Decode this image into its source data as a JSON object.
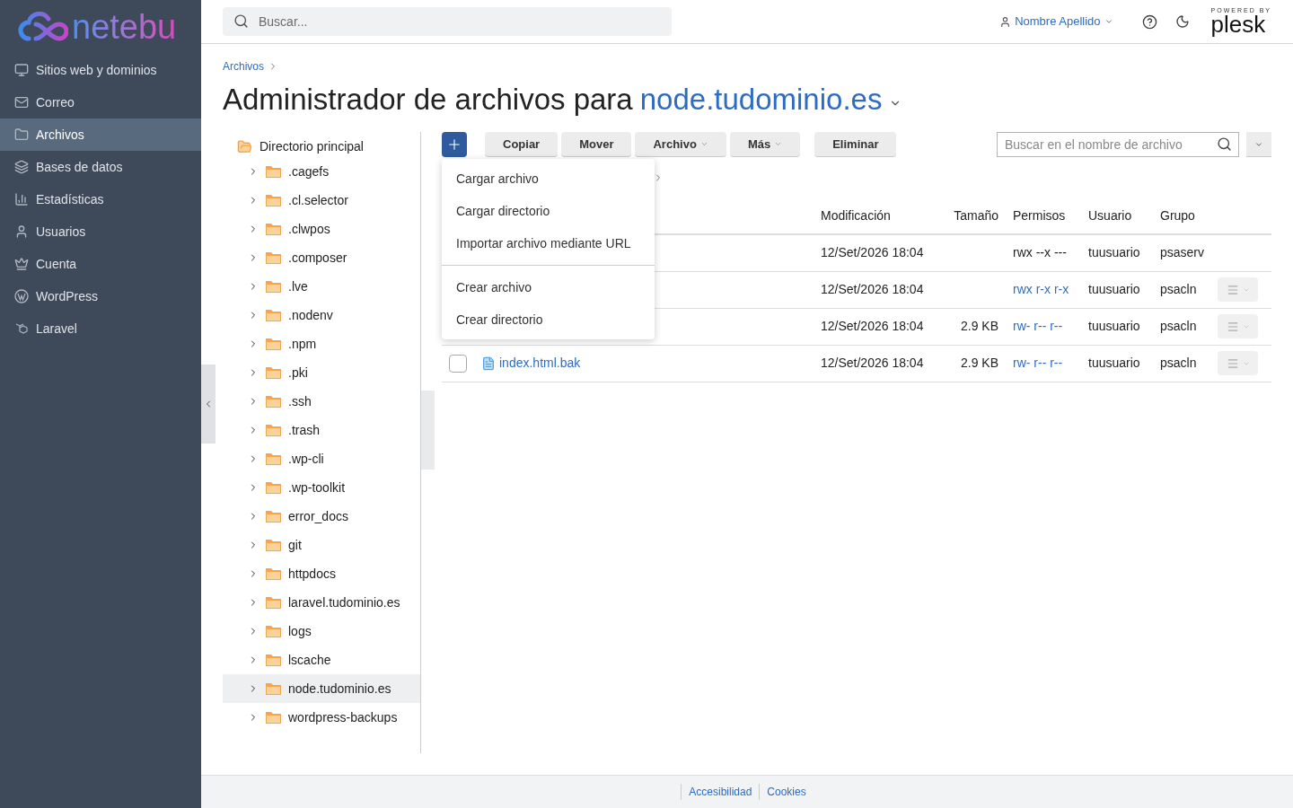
{
  "sidebar": {
    "logo": "netebu",
    "items": [
      {
        "label": "Sitios web y dominios",
        "selected": false
      },
      {
        "label": "Correo",
        "selected": false
      },
      {
        "label": "Archivos",
        "selected": true
      },
      {
        "label": "Bases de datos",
        "selected": false
      },
      {
        "label": "Estadísticas",
        "selected": false
      },
      {
        "label": "Usuarios",
        "selected": false
      },
      {
        "label": "Cuenta",
        "selected": false
      },
      {
        "label": "WordPress",
        "selected": false
      },
      {
        "label": "Laravel",
        "selected": false
      }
    ]
  },
  "header": {
    "search_placeholder": "Buscar...",
    "user": "Nombre Apellido",
    "powered_by": "POWERED BY",
    "brand": "plesk"
  },
  "breadcrumb": [
    "Archivos"
  ],
  "title": {
    "text": "Administrador de archivos para",
    "domain": "node.tudominio.es"
  },
  "tree": {
    "root": "Directorio principal",
    "children": [
      {
        "label": ".cagefs",
        "selected": false
      },
      {
        "label": ".cl.selector",
        "selected": false
      },
      {
        "label": ".clwpos",
        "selected": false
      },
      {
        "label": ".composer",
        "selected": false
      },
      {
        "label": ".lve",
        "selected": false
      },
      {
        "label": ".nodenv",
        "selected": false
      },
      {
        "label": ".npm",
        "selected": false
      },
      {
        "label": ".pki",
        "selected": false
      },
      {
        "label": ".ssh",
        "selected": false
      },
      {
        "label": ".trash",
        "selected": false
      },
      {
        "label": ".wp-cli",
        "selected": false
      },
      {
        "label": ".wp-toolkit",
        "selected": false
      },
      {
        "label": "error_docs",
        "selected": false
      },
      {
        "label": "git",
        "selected": false
      },
      {
        "label": "httpdocs",
        "selected": false
      },
      {
        "label": "laravel.tudominio.es",
        "selected": false
      },
      {
        "label": "logs",
        "selected": false
      },
      {
        "label": "lscache",
        "selected": false
      },
      {
        "label": "node.tudominio.es",
        "selected": true
      },
      {
        "label": "wordpress-backups",
        "selected": false
      }
    ]
  },
  "toolbar": {
    "buttons": [
      {
        "label": "Copiar",
        "dropdown": false
      },
      {
        "label": "Mover",
        "dropdown": false
      },
      {
        "label": "Archivo",
        "dropdown": true
      },
      {
        "label": "Más",
        "dropdown": true
      },
      {
        "label": "Eliminar",
        "dropdown": false
      }
    ],
    "search_placeholder": "Buscar en el nombre de archivo"
  },
  "add_menu": {
    "groups": [
      [
        "Cargar archivo",
        "Cargar directorio",
        "Importar archivo mediante URL"
      ],
      [
        "Crear archivo",
        "Crear directorio"
      ]
    ]
  },
  "table": {
    "columns": [
      "Modificación",
      "Tamaño",
      "Permisos",
      "Usuario",
      "Grupo"
    ],
    "rows": [
      {
        "modified": "12/Set/2026 18:04",
        "permissions": "rwx --x ---",
        "permissions_link": false,
        "user": "tuusuario",
        "group": "psaserv",
        "menu": false
      },
      {
        "modified": "12/Set/2026 18:04",
        "permissions": "rwx r-x r-x",
        "permissions_link": true,
        "user": "tuusuario",
        "group": "psacln",
        "menu": true
      },
      {
        "modified": "12/Set/2026 18:04",
        "size": "2.9 KB",
        "permissions": "rw- r-- r--",
        "permissions_link": true,
        "user": "tuusuario",
        "group": "psacln",
        "menu": true
      },
      {
        "name": "index.html.bak",
        "checked": false,
        "modified": "12/Set/2026 18:04",
        "size": "2.9 KB",
        "permissions": "rw- r-- r--",
        "permissions_link": true,
        "user": "tuusuario",
        "group": "psacln",
        "menu": true
      }
    ]
  },
  "footer": {
    "links": [
      "Accesibilidad",
      "Cookies"
    ]
  }
}
